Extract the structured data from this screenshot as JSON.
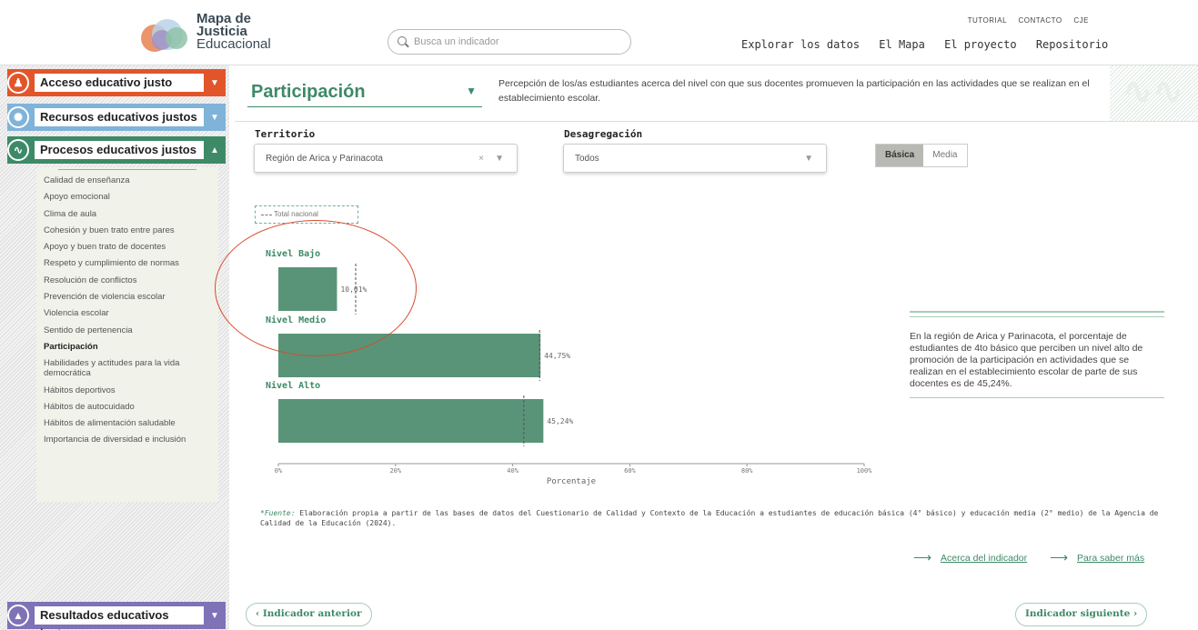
{
  "header": {
    "logo": {
      "line1": "Mapa de",
      "line2": "Justicia",
      "line3": "Educacional"
    },
    "search_placeholder": "Busca un indicador",
    "top_links": [
      "TUTORIAL",
      "CONTACTO",
      "CJE"
    ],
    "main_nav": [
      "Explorar los datos",
      "El Mapa",
      "El proyecto",
      "Repositorio"
    ]
  },
  "sidebar": {
    "sections": [
      {
        "label": "Acceso educativo justo",
        "color": "#e2552a"
      },
      {
        "label": "Recursos educativos justos",
        "color": "#7fb3d9"
      },
      {
        "label": "Procesos educativos justos",
        "color": "#3d8a67"
      },
      {
        "label": "Resultados educativos justos",
        "color": "#7f72b6"
      }
    ],
    "items": [
      "Calidad de enseñanza",
      "Apoyo emocional",
      "Clima de aula",
      "Cohesión y buen trato entre pares",
      "Apoyo y buen trato de docentes",
      "Respeto y cumplimiento de normas",
      "Resolución de conflictos",
      "Prevención de violencia escolar",
      "Violencia escolar",
      "Sentido de pertenencia",
      "Participación",
      "Habilidades y actitudes para la vida democrática",
      "Hábitos deportivos",
      "Hábitos de autocuidado",
      "Hábitos de alimentación saludable",
      "Importancia de diversidad e inclusión"
    ],
    "active_item": "Participación"
  },
  "indicator": {
    "title": "Participación",
    "description": "Percepción de los/as estudiantes acerca del nivel con que sus docentes promueven la participación en las actividades que se realizan en el establecimiento escolar."
  },
  "filters": {
    "territorio_label": "Territorio",
    "territorio_value": "Región de Arica y Parinacota",
    "desagregacion_label": "Desagregación",
    "desagregacion_value": "Todos",
    "level_options": [
      "Básica",
      "Media"
    ],
    "level_selected": "Básica"
  },
  "chart_data": {
    "type": "bar",
    "orientation": "horizontal",
    "categories": [
      "Nivel Bajo",
      "Nivel Medio",
      "Nivel Alto"
    ],
    "values": [
      10.01,
      44.75,
      45.24
    ],
    "value_labels": [
      "10,01%",
      "44,75%",
      "45,24%"
    ],
    "national_reference": [
      13.2,
      44.6,
      41.9
    ],
    "legend": "Total nacional",
    "xlabel": "Porcentaje",
    "xticks": [
      "0%",
      "20%",
      "40%",
      "60%",
      "80%",
      "100%"
    ],
    "xlim": [
      0,
      100
    ],
    "bar_color": "#5a9478"
  },
  "source_note": {
    "label": "*Fuente:",
    "text": " Elaboración propia a partir de las bases de datos del Cuestionario de Calidad y Contexto de la Educación a estudiantes de educación básica (4° básico) y educación media (2° medio) de la Agencia de Calidad de la Educación (2024)."
  },
  "info_panel": {
    "text": "En la región de Arica y Parinacota, el porcentaje de estudiantes de 4to básico que perciben un nivel alto de promoción de la participación en actividades que se realizan en el establecimiento escolar de parte de sus docentes es de 45,24%."
  },
  "links": {
    "about": "Acerca del indicador",
    "more": "Para saber más"
  },
  "pager": {
    "prev": "Indicador anterior",
    "next": "Indicador siguiente"
  }
}
